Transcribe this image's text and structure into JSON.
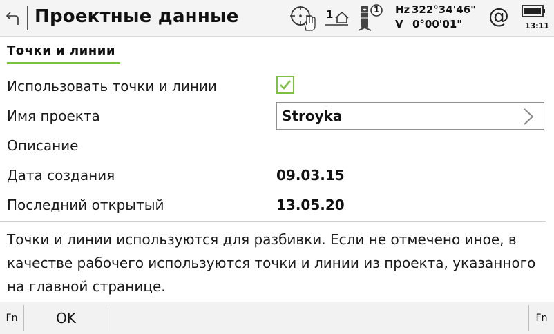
{
  "header": {
    "title": "Проектные данные",
    "icons": [
      "back-arrow-icon",
      "compensator-level-icon",
      "hand-icon",
      "station-home-icon",
      "prism-target-icon",
      "at-sign-icon",
      "battery-icon"
    ],
    "station_number": "1",
    "target_number": "1",
    "hz_label": "Hz",
    "hz_value": "322°34'46\"",
    "v_label": "V",
    "v_value": "0°00'01\"",
    "at_symbol": "@",
    "time": "13:11"
  },
  "section": {
    "title": "Точки и линии"
  },
  "form": {
    "use_points_label": "Использовать точки и линии",
    "use_points_checked": true,
    "project_name_label": "Имя проекта",
    "project_name_value": "Stroyka",
    "description_label": "Описание",
    "description_value": "",
    "created_label": "Дата создания",
    "created_value": "09.03.15",
    "last_opened_label": "Последний открытый",
    "last_opened_value": "13.05.20"
  },
  "info": {
    "text": "Точки и линии используются для разбивки. Если не отмечено иное, в качестве рабочего используются точки и линии из проекта, указанного на главной странице."
  },
  "softkeys": {
    "fn_left": "Fn",
    "ok": "OK",
    "fn_right": "Fn"
  },
  "colors": {
    "accent_green": "#7cc242",
    "header_bg": "#f4f4f4",
    "softbar_bg": "#f2f2f2"
  }
}
